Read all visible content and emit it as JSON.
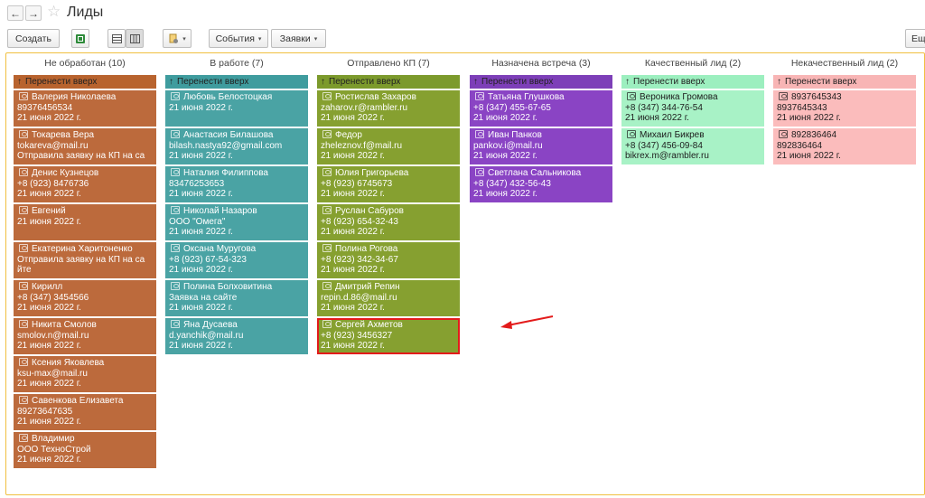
{
  "window": {
    "title": "Лиды"
  },
  "nav": {
    "back_glyph": "←",
    "forward_glyph": "→",
    "favorite_glyph": "☆"
  },
  "toolbar": {
    "create_label": "Создать",
    "events_label": "События",
    "requests_label": "Заявки",
    "more_label": "Ещ",
    "caret": "▾"
  },
  "move_up_label": "Перенести вверх",
  "move_up_glyph": "↑",
  "columns": [
    {
      "title": "Не обработан (10)",
      "move_color": "#b8632e",
      "card_color": "#bc6a3c",
      "text_dark": false,
      "cards": [
        {
          "name": "Валерия Николаева",
          "line2": "89376456534",
          "line3": "21 июня 2022 г."
        },
        {
          "name": "Токарева Вера",
          "line2": "tokareva@mail.ru",
          "line3": "Отправила заявку на КП на са"
        },
        {
          "name": "Денис Кузнецов",
          "line2": "+8 (923) 8476736",
          "line3": "21 июня 2022 г."
        },
        {
          "name": "Евгений",
          "line2": "21 июня 2022 г.",
          "line3": ""
        },
        {
          "name": "Екатерина Харитоненко",
          "line2": "Отправила заявку на КП на са",
          "line3": "йте"
        },
        {
          "name": "Кирилл",
          "line2": "+8 (347) 3454566",
          "line3": "21 июня 2022 г."
        },
        {
          "name": "Никита Смолов",
          "line2": "smolov.n@mail.ru",
          "line3": "21 июня 2022 г."
        },
        {
          "name": "Ксения Яковлева",
          "line2": "ksu-max@mail.ru",
          "line3": "21 июня 2022 г."
        },
        {
          "name": "Савенкова Елизавета",
          "line2": "89273647635",
          "line3": "21 июня 2022 г."
        },
        {
          "name": "Владимир",
          "line2": "ООО ТехноСтрой",
          "line3": "21 июня 2022 г."
        }
      ]
    },
    {
      "title": "В работе (7)",
      "move_color": "#3f9c9e",
      "card_color": "#4aa3a4",
      "text_dark": false,
      "cards": [
        {
          "name": "Любовь Белостоцкая",
          "line2": "21 июня 2022 г.",
          "line3": ""
        },
        {
          "name": "Анастасия Билашова",
          "line2": "bilash.nastya92@gmail.com",
          "line3": "21 июня 2022 г."
        },
        {
          "name": "Наталия Филиппова",
          "line2": "83476253653",
          "line3": "21 июня 2022 г."
        },
        {
          "name": "Николай Назаров",
          "line2": "ООО \"Омега\"",
          "line3": "21 июня 2022 г."
        },
        {
          "name": "Оксана Муругова",
          "line2": "+8 (923) 67-54-323",
          "line3": "21 июня 2022 г."
        },
        {
          "name": "Полина Болховитина",
          "line2": "Заявка на сайте",
          "line3": "21 июня 2022 г."
        },
        {
          "name": "Яна Дусаева",
          "line2": "d.yanchik@mail.ru",
          "line3": "21 июня 2022 г."
        }
      ]
    },
    {
      "title": "Отправлено КП (7)",
      "move_color": "#7c9a2c",
      "card_color": "#86a030",
      "text_dark": false,
      "cards": [
        {
          "name": "Ростислав Захаров",
          "line2": "zaharov.r@rambler.ru",
          "line3": "21 июня 2022 г."
        },
        {
          "name": "Федор",
          "line2": "zheleznov.f@mail.ru",
          "line3": "21 июня 2022 г."
        },
        {
          "name": "Юлия Григорьева",
          "line2": "+8 (923) 6745673",
          "line3": "21 июня 2022 г."
        },
        {
          "name": "Руслан Сабуров",
          "line2": "+8 (923) 654-32-43",
          "line3": "21 июня 2022 г."
        },
        {
          "name": "Полина Рогова",
          "line2": "+8 (923) 342-34-67",
          "line3": "21 июня 2022 г."
        },
        {
          "name": "Дмитрий Репин",
          "line2": "repin.d.86@mail.ru",
          "line3": "21 июня 2022 г."
        },
        {
          "name": "Сергей Ахметов",
          "line2": "+8 (923) 3456327",
          "line3": "21 июня 2022 г.",
          "selected": true
        }
      ]
    },
    {
      "title": "Назначена встреча (3)",
      "move_color": "#7d3fb8",
      "card_color": "#8a44c4",
      "text_dark": false,
      "cards": [
        {
          "name": "Татьяна Глушкова",
          "line2": "+8 (347) 455-67-65",
          "line3": "21 июня 2022 г."
        },
        {
          "name": "Иван Панков",
          "line2": "pankov.i@mail.ru",
          "line3": "21 июня 2022 г."
        },
        {
          "name": "Светлана Сальникова",
          "line2": "+8 (347) 432-56-43",
          "line3": "21 июня 2022 г."
        }
      ]
    },
    {
      "title": "Качественный лид (2)",
      "move_color": "#9cefbf",
      "card_color": "#a8f2c6",
      "text_dark": true,
      "cards": [
        {
          "name": "Вероника Громова",
          "line2": "+8 (347) 344-76-54",
          "line3": "21 июня 2022 г."
        },
        {
          "name": "Михаил Бикрев",
          "line2": "+8 (347) 456-09-84",
          "line3": "bikrex.m@rambler.ru"
        }
      ]
    },
    {
      "title": "Некачественный лид (2)",
      "move_color": "#f8b5b5",
      "card_color": "#fbbcbc",
      "text_dark": true,
      "cards": [
        {
          "name": "8937645343",
          "line2": "8937645343",
          "line3": "21 июня 2022 г."
        },
        {
          "name": "892836464",
          "line2": "892836464",
          "line3": "21 июня 2022 г."
        }
      ]
    }
  ],
  "annotation": {
    "arrow_color": "#e31b1b"
  }
}
